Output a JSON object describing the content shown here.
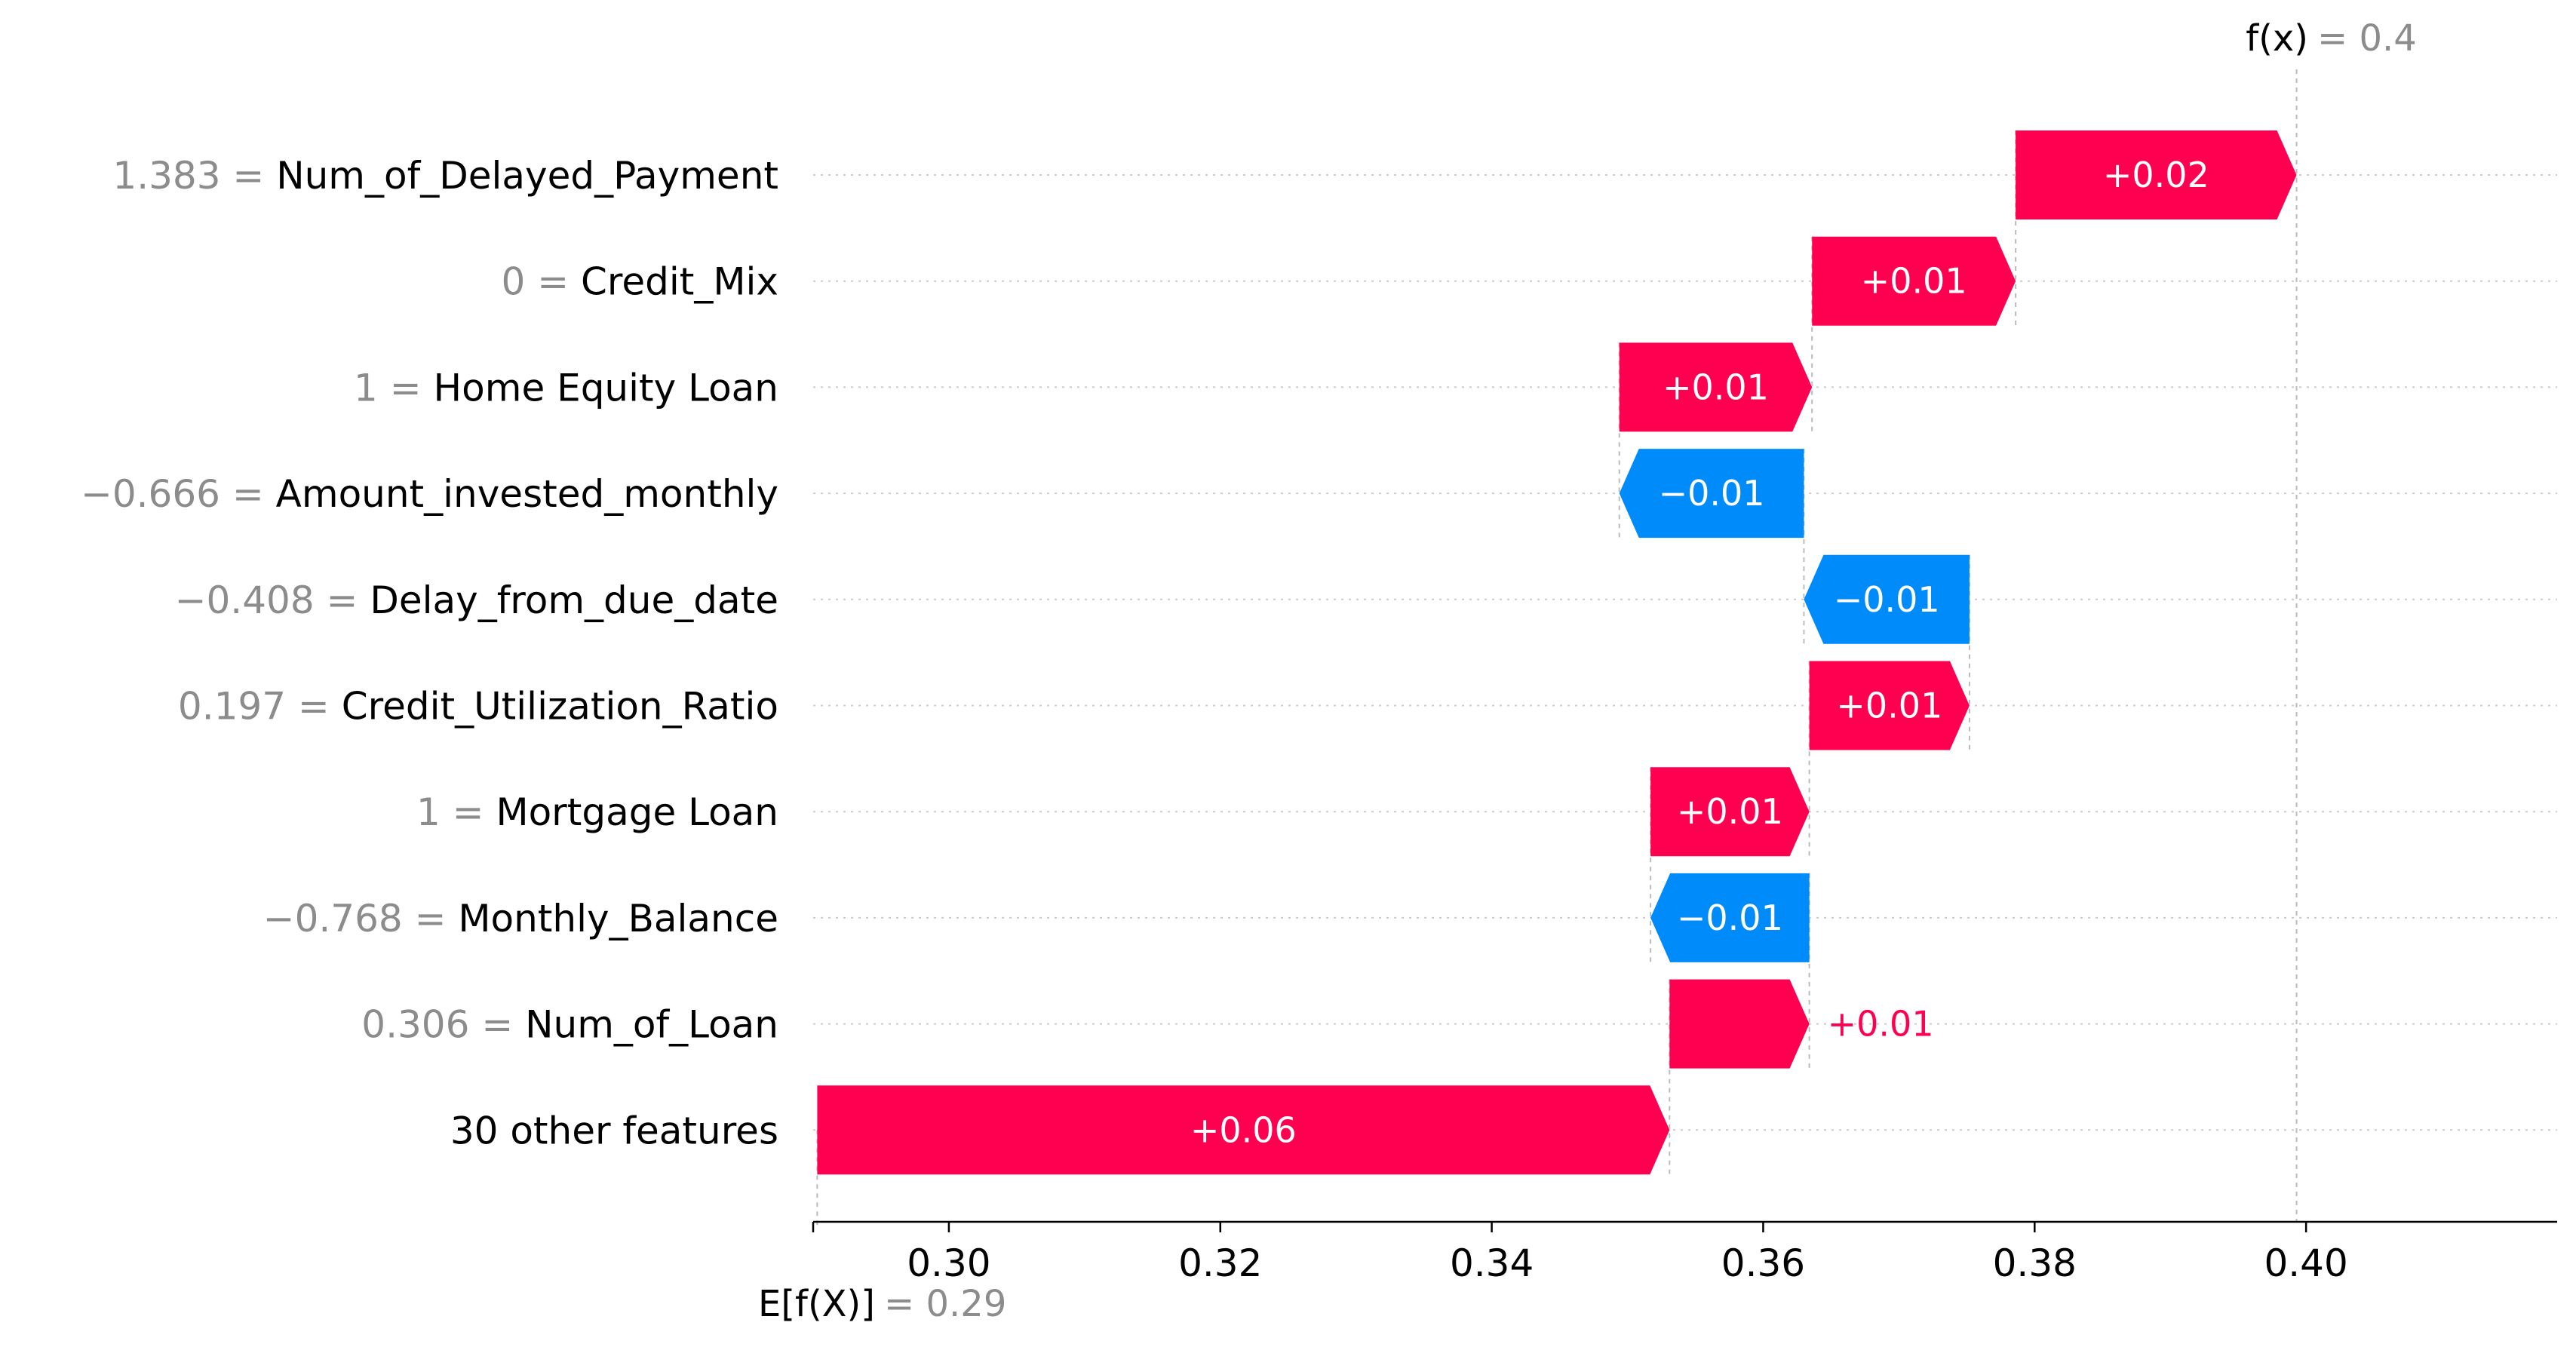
{
  "chart_data": {
    "type": "waterfall",
    "title": "",
    "xlabel": "",
    "ylabel": "",
    "xlim": [
      0.29,
      0.4185
    ],
    "xticks": [
      0.3,
      0.32,
      0.34,
      0.36,
      0.38,
      0.4
    ],
    "xtick_labels": [
      "0.30",
      "0.32",
      "0.34",
      "0.36",
      "0.38",
      "0.40"
    ],
    "grid": "horizontal dotted",
    "base_value": 0.2903,
    "final_value": 0.3993,
    "expected_label": "E[f(X)]",
    "expected_value_text": "= 0.29",
    "output_label": "f(x)",
    "output_value_text": "= 0.4",
    "features": [
      {
        "value": "1.383",
        "name": "Num_of_Delayed_Payment",
        "start": 0.3786,
        "end": 0.3993,
        "label": "+0.02"
      },
      {
        "value": "0",
        "name": "Credit_Mix",
        "start": 0.3636,
        "end": 0.3786,
        "label": "+0.01"
      },
      {
        "value": "1",
        "name": "Home Equity Loan",
        "start": 0.3494,
        "end": 0.3636,
        "label": "+0.01"
      },
      {
        "value": "−0.666",
        "name": "Amount_invested_monthly",
        "start": 0.363,
        "end": 0.3494,
        "label": "−0.01"
      },
      {
        "value": "−0.408",
        "name": "Delay_from_due_date",
        "start": 0.3752,
        "end": 0.363,
        "label": "−0.01"
      },
      {
        "value": "0.197",
        "name": "Credit_Utilization_Ratio",
        "start": 0.3634,
        "end": 0.3752,
        "label": "+0.01"
      },
      {
        "value": "1",
        "name": "Mortgage Loan",
        "start": 0.3517,
        "end": 0.3634,
        "label": "+0.01"
      },
      {
        "value": "−0.768",
        "name": "Monthly_Balance",
        "start": 0.3634,
        "end": 0.3517,
        "label": "−0.01"
      },
      {
        "value": "0.306",
        "name": "Num_of_Loan",
        "start": 0.3531,
        "end": 0.3634,
        "label": "+0.01"
      },
      {
        "value": "",
        "name": "30 other features",
        "start": 0.2903,
        "end": 0.3531,
        "label": "+0.06"
      }
    ],
    "colors": {
      "positive": "#ff0051",
      "negative": "#008bfb",
      "feature_value": "#8c8c8c",
      "grid": "#cccccc"
    }
  }
}
